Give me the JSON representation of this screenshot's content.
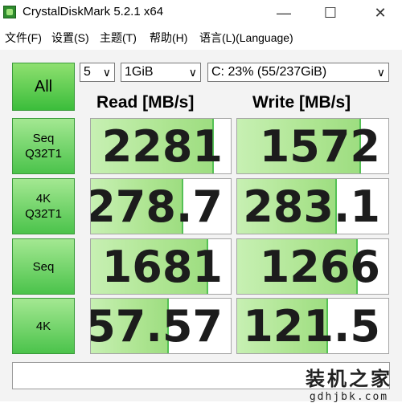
{
  "window": {
    "title": "CrystalDiskMark 5.2.1 x64",
    "icon": "crystaldiskmark-app-icon",
    "controls": {
      "minimize": "—",
      "maximize": "☐",
      "close": "✕"
    }
  },
  "menu": {
    "items": [
      "文件(F)",
      "设置(S)",
      "主题(T)",
      "帮助(H)",
      "语言(L)(Language)"
    ]
  },
  "controls": {
    "all_label": "All",
    "runs": "5",
    "size": "1GiB",
    "drive": "C: 23% (55/237GiB)"
  },
  "columns": {
    "read": "Read [MB/s]",
    "write": "Write [MB/s]"
  },
  "rows": [
    {
      "label_line1": "Seq",
      "label_line2": "Q32T1",
      "read": "2281",
      "write": "1572",
      "read_fill": 0.88,
      "write_fill": 0.82
    },
    {
      "label_line1": "4K",
      "label_line2": "Q32T1",
      "read": "278.7",
      "write": "283.1",
      "read_fill": 0.66,
      "write_fill": 0.66
    },
    {
      "label_line1": "Seq",
      "label_line2": "",
      "read": "1681",
      "write": "1266",
      "read_fill": 0.84,
      "write_fill": 0.8
    },
    {
      "label_line1": "4K",
      "label_line2": "",
      "read": "57.57",
      "write": "121.5",
      "read_fill": 0.56,
      "write_fill": 0.6
    }
  ],
  "comment": "",
  "watermark": {
    "text": "装机之家",
    "url": "gdhjbk.com"
  },
  "colors": {
    "accent_green": "#4bc34b",
    "fill_green": "#aee592"
  }
}
